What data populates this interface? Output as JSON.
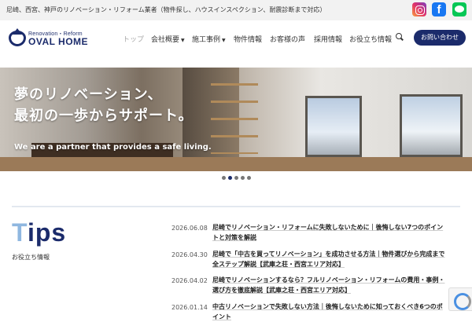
{
  "topbar": {
    "tagline": "尼崎、西宮、神戸のリノベーション・リフォーム業者（物件探し、ハウスインスペクション、耐震診断まで対応）",
    "social": [
      "instagram-icon",
      "facebook-icon",
      "line-icon"
    ],
    "facebook_glyph": "f"
  },
  "logo": {
    "sub": "Renovation・Reform",
    "name": "OVAL HOME",
    "brand_color": "#1b2b6b"
  },
  "nav": {
    "items": [
      {
        "label": "トップ",
        "active": true
      },
      {
        "label": "会社概要",
        "dropdown": true
      },
      {
        "label": "施工事例",
        "dropdown": true
      },
      {
        "label": "物件情報"
      },
      {
        "label": "お客様の声"
      },
      {
        "label": "採用情報"
      },
      {
        "label": "お役立ち情報"
      }
    ],
    "caret": "▼",
    "contact": "お問い合わせ"
  },
  "hero": {
    "line1": "夢のリノベーション、",
    "line2": "最初の一歩からサポート。",
    "tagline": "We are a partner that provides a safe living.",
    "slides": 5,
    "active_slide": 1
  },
  "tips": {
    "title_initial": "T",
    "title_rest": "ips",
    "subtitle": "お役立ち情報",
    "posts": [
      {
        "date": "2026.06.08",
        "title": "尼崎でリノベーション・リフォームに失敗しないために｜後悔しない7つのポイントと対策を解説"
      },
      {
        "date": "2026.04.30",
        "title": "尼崎で「中古を買ってリノベーション」を成功させる方法｜物件選びから完成まで全ステップ解説【武庫之荘・西宮エリア対応】"
      },
      {
        "date": "2026.04.02",
        "title": "尼崎でリノベーションするなら？フルリノベーション・リフォームの費用・事例・選び方を徹底解説【武庫之荘・西宮エリア対応】"
      },
      {
        "date": "2026.01.14",
        "title": "中古リノベーションで失敗しない方法｜後悔しないために知っておくべき6つのポイント"
      }
    ]
  }
}
